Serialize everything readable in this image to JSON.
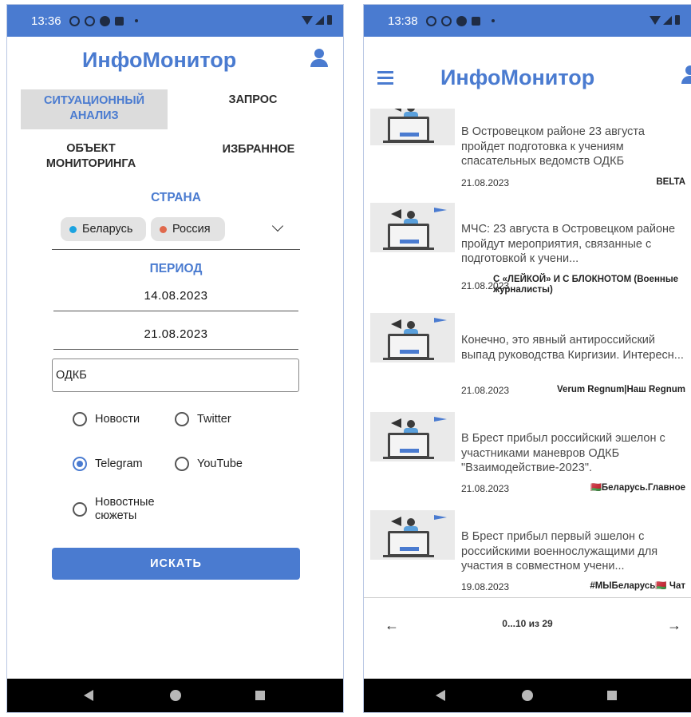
{
  "screen1": {
    "status_time": "13:36",
    "app_title": "ИнфоМонитор",
    "tabs": [
      {
        "label": "СИТУАЦИОННЫЙ АНАЛИЗ",
        "active": true
      },
      {
        "label": "ЗАПРОС",
        "active": false
      },
      {
        "label": "ОБЪЕКТ МОНИТОРИНГА",
        "active": false
      },
      {
        "label": "ИЗБРАННОЕ",
        "active": false
      }
    ],
    "country_label": "СТРАНА",
    "countries": [
      {
        "label": "Беларусь",
        "color": "#1ba3e0"
      },
      {
        "label": "Россия",
        "color": "#e0694c"
      }
    ],
    "period_label": "ПЕРИОД",
    "date_from": "14.08.2023",
    "date_to": "21.08.2023",
    "query_value": "ОДКБ",
    "sources": [
      {
        "label": "Новости",
        "checked": false
      },
      {
        "label": "Twitter",
        "checked": false
      },
      {
        "label": "Telegram",
        "checked": true
      },
      {
        "label": "YouTube",
        "checked": false
      },
      {
        "label": "Новостные сюжеты",
        "checked": false
      }
    ],
    "search_button": "ИСКАТЬ"
  },
  "screen2": {
    "status_time": "13:38",
    "app_title": "ИнфоМонитор",
    "news": [
      {
        "title": "В Островецком районе 23 августа пройдет подготовка к учениям спасательных ведомств ОДКБ",
        "date": "21.08.2023",
        "source": "BELTA"
      },
      {
        "title": "МЧС: 23 августа в Островецком районе пройдут мероприятия, связанные с подготовкой к учени...",
        "date": "21.08.2023",
        "source": "С «ЛЕЙКОЙ» И С БЛОКНОТОМ (Военные журналисты)"
      },
      {
        "title": "Конечно, это явный антироссийский выпад руководства Киргизии. Интересн...",
        "date": "21.08.2023",
        "source": "Verum Regnum|Наш Regnum"
      },
      {
        "title": "В Брест прибыл российский эшелон с участниками маневров ОДКБ \"Взаимодействие-2023\".",
        "date": "21.08.2023",
        "source": "🇧🇾Беларусь.Главное"
      },
      {
        "title": "В Брест прибыл первый эшелон с российскими военнослужащими для участия в совместном учени...",
        "date": "19.08.2023",
        "source": "#МЫБеларусь🇧🇾 Чат"
      }
    ],
    "pagination": "0...10 из 29",
    "prev_arrow": "←",
    "next_arrow": "→"
  },
  "colors": {
    "accent": "#4a7bd0",
    "status_bar": "#4a7bd0",
    "nav_bar": "#000000"
  }
}
